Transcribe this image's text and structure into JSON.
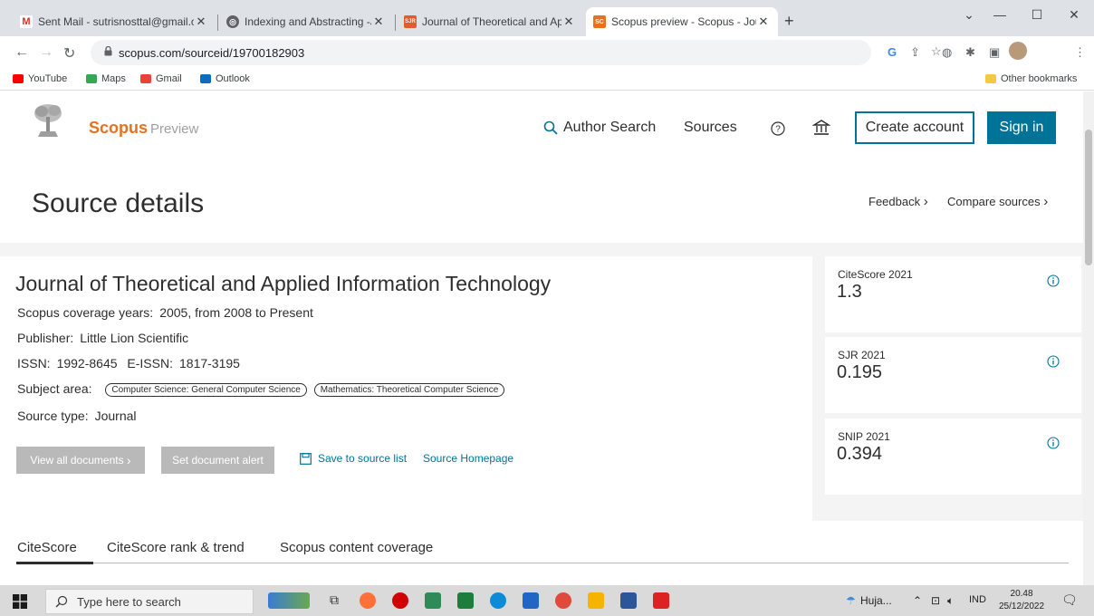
{
  "browser": {
    "tabs": [
      {
        "title": "Sent Mail - sutrisnosttal@gmail.c",
        "favicon": "gmail-icon"
      },
      {
        "title": "Indexing and Abstracting -Journa",
        "favicon": "globe-icon"
      },
      {
        "title": "Journal of Theoretical and Applie",
        "favicon": "sjr-icon",
        "favicon_text": "SJR"
      },
      {
        "title": "Scopus preview - Scopus - Journ",
        "favicon": "scopus-icon",
        "favicon_text": "SC",
        "active": true
      }
    ],
    "url": "scopus.com/sourceid/19700182903",
    "bookmarks": [
      "YouTube",
      "Maps",
      "Gmail",
      "Outlook"
    ],
    "other_bookmarks": "Other bookmarks"
  },
  "header": {
    "brand": "Scopus",
    "brand_sub": "Preview",
    "author_search": "Author Search",
    "sources": "Sources",
    "create_account": "Create account",
    "sign_in": "Sign in"
  },
  "page": {
    "title": "Source details",
    "feedback": "Feedback",
    "compare": "Compare sources"
  },
  "journal": {
    "title": "Journal of Theoretical and Applied Information Technology",
    "coverage_label": "Scopus coverage years:",
    "coverage_value": "2005, from 2008 to Present",
    "publisher_label": "Publisher:",
    "publisher_value": "Little Lion Scientific",
    "issn_label": "ISSN:",
    "issn_value": "1992-8645",
    "eissn_label": "E-ISSN:",
    "eissn_value": "1817-3195",
    "subject_label": "Subject area:",
    "subjects": [
      "Computer Science: General Computer Science",
      "Mathematics: Theoretical Computer Science"
    ],
    "source_type_label": "Source type:",
    "source_type_value": "Journal",
    "view_all": "View all documents",
    "set_alert": "Set document alert",
    "save_list": "Save to source list",
    "homepage": "Source Homepage"
  },
  "metrics": [
    {
      "label": "CiteScore 2021",
      "value": "1.3"
    },
    {
      "label": "SJR 2021",
      "value": "0.195"
    },
    {
      "label": "SNIP 2021",
      "value": "0.394"
    }
  ],
  "content_tabs": [
    "CiteScore",
    "CiteScore rank & trend",
    "Scopus content coverage"
  ],
  "taskbar": {
    "search_placeholder": "Type here to search",
    "weather": "Huja...",
    "lang": "IND",
    "time": "20.48",
    "date": "25/12/2022"
  }
}
